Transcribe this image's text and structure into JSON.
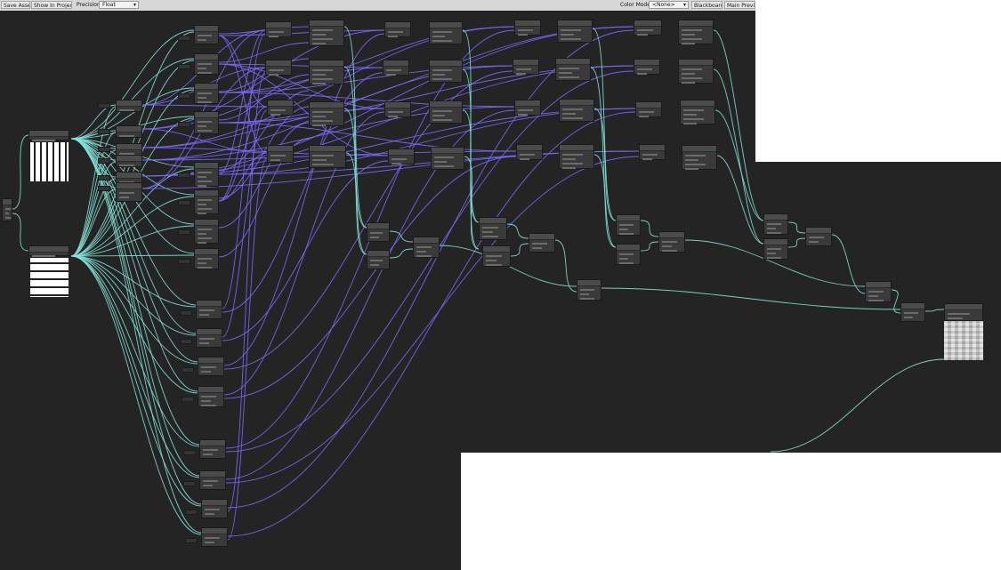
{
  "toolbar": {
    "save_asset": "Save Asset",
    "show_in_project": "Show In Project",
    "precision_label": "Precision",
    "precision_value": "Float",
    "color_mode_label": "Color Mode",
    "color_mode_value": "<None>",
    "blackboard": "Blackboard",
    "main_preview": "Main Preview"
  },
  "colors": {
    "graph_background": "#242424",
    "wire_vector": "#7a6cff",
    "wire_float": "#84e2d8",
    "node_body": "#3a3a3a"
  },
  "icons": {
    "dropdown": "chevron-down-icon"
  }
}
